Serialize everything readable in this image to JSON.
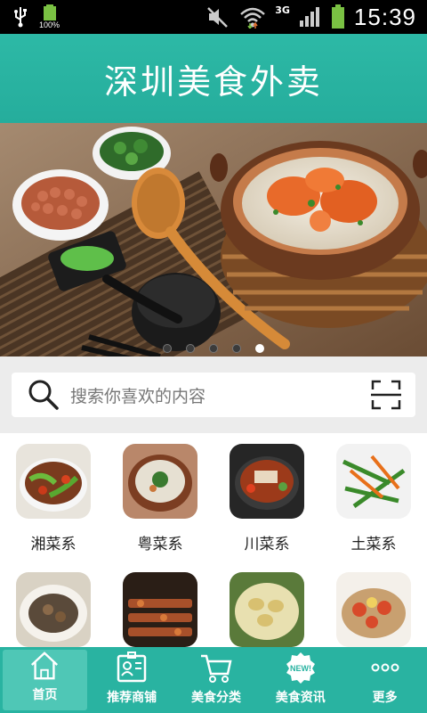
{
  "status_bar": {
    "battery_small_percent": "100%",
    "network_type": "3G",
    "time": "15:39"
  },
  "header": {
    "title": "深圳美食外卖"
  },
  "banner": {
    "dot_count": 5,
    "active_index": 4
  },
  "search": {
    "placeholder": "搜索你喜欢的内容"
  },
  "categories": [
    {
      "label": "湘菜系",
      "icon": "hunan-dish-image"
    },
    {
      "label": "粤菜系",
      "icon": "cantonese-dish-image"
    },
    {
      "label": "川菜系",
      "icon": "sichuan-dish-image"
    },
    {
      "label": "土菜系",
      "icon": "home-style-dish-image"
    },
    {
      "label": "",
      "icon": "clay-pot-dish-image"
    },
    {
      "label": "",
      "icon": "skewers-dish-image"
    },
    {
      "label": "",
      "icon": "abalone-dish-image"
    },
    {
      "label": "",
      "icon": "seafood-platter-image"
    }
  ],
  "bottom_nav": [
    {
      "label": "首页",
      "icon": "home-icon",
      "active": true
    },
    {
      "label": "推荐商铺",
      "icon": "shop-card-icon",
      "active": false
    },
    {
      "label": "美食分类",
      "icon": "cart-icon",
      "active": false
    },
    {
      "label": "美食资讯",
      "icon": "new-badge-icon",
      "active": false
    },
    {
      "label": "更多",
      "icon": "more-dots-icon",
      "active": false
    }
  ],
  "colors": {
    "teal": "#2db9a6",
    "nav_active": "#4fc7b6",
    "search_bg": "#ececec"
  }
}
